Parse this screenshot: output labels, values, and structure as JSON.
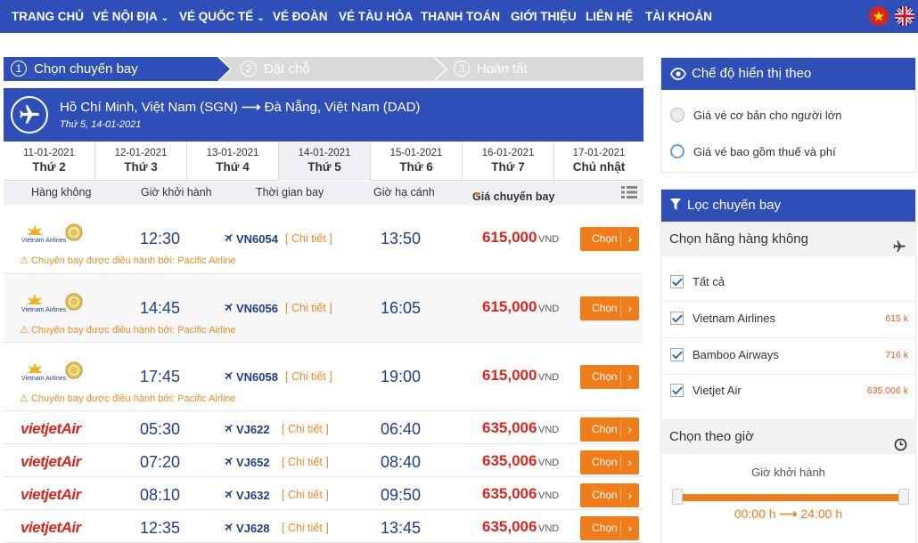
{
  "nav": {
    "items": [
      {
        "label": "TRANG CHỦ",
        "caret": false
      },
      {
        "label": "VÉ NỘI ĐỊA",
        "caret": true
      },
      {
        "label": "VÉ QUỐC TẾ",
        "caret": true
      },
      {
        "label": "VÉ ĐOÀN",
        "caret": false
      },
      {
        "label": "VÉ TÀU HỎA",
        "caret": false
      },
      {
        "label": "THANH TOÁN",
        "caret": false
      },
      {
        "label": "GIỚI THIỆU",
        "caret": false
      },
      {
        "label": "LIÊN HỆ",
        "caret": false
      },
      {
        "label": "TÀI KHOẢN",
        "caret": false
      }
    ],
    "flags": [
      "vietnam-flag-icon",
      "uk-flag-icon"
    ]
  },
  "steps": [
    {
      "num": "1",
      "label": "Chọn chuyến bay",
      "active": true
    },
    {
      "num": "2",
      "label": "Đặt chỗ",
      "active": false
    },
    {
      "num": "3",
      "label": "Hoàn tất",
      "active": false
    }
  ],
  "route": {
    "from": "Hồ Chí Minh, Việt Nam (SGN)",
    "to": "Đà Nẵng, Việt Nam (DAD)",
    "date": "Thứ 5, 14-01-2021"
  },
  "dates": [
    {
      "date": "11-01-2021",
      "day": "Thứ 2"
    },
    {
      "date": "12-01-2021",
      "day": "Thứ 3"
    },
    {
      "date": "13-01-2021",
      "day": "Thứ 4"
    },
    {
      "date": "14-01-2021",
      "day": "Thứ 5",
      "active": true
    },
    {
      "date": "15-01-2021",
      "day": "Thứ 6"
    },
    {
      "date": "16-01-2021",
      "day": "Thứ 7"
    },
    {
      "date": "17-01-2021",
      "day": "Chủ nhật"
    }
  ],
  "columns": {
    "airline": "Hàng không",
    "depart": "Giờ khởi hành",
    "duration": "Thời gian bay",
    "arrive": "Giờ hạ cánh",
    "price": "Giá chuyến bay"
  },
  "flights": [
    {
      "airline": "Vietnam Airlines",
      "depart": "12:30",
      "flight": "VN6054",
      "detail": "[ Chi tiết ]",
      "arrive": "13:50",
      "price": "615,000",
      "currency": "VND",
      "button": "Chọn",
      "note": "Chuyến bay được điều hành bởi: Pacific Airline"
    },
    {
      "airline": "Vietnam Airlines",
      "depart": "14:45",
      "flight": "VN6056",
      "detail": "[ Chi tiết ]",
      "arrive": "16:05",
      "price": "615,000",
      "currency": "VND",
      "button": "Chọn",
      "note": "Chuyến bay được điều hành bởi: Pacific Airline"
    },
    {
      "airline": "Vietnam Airlines",
      "depart": "17:45",
      "flight": "VN6058",
      "detail": "[ Chi tiết ]",
      "arrive": "19:00",
      "price": "615,000",
      "currency": "VND",
      "button": "Chọn",
      "note": "Chuyến bay được điều hành bởi: Pacific Airline"
    },
    {
      "airline": "VietjetAir",
      "depart": "05:30",
      "flight": "VJ622",
      "detail": "[ Chi tiết ]",
      "arrive": "06:40",
      "price": "635,006",
      "currency": "VND",
      "button": "Chọn"
    },
    {
      "airline": "VietjetAir",
      "depart": "07:20",
      "flight": "VJ652",
      "detail": "[ Chi tiết ]",
      "arrive": "08:40",
      "price": "635,006",
      "currency": "VND",
      "button": "Chọn"
    },
    {
      "airline": "VietjetAir",
      "depart": "08:10",
      "flight": "VJ632",
      "detail": "[ Chi tiết ]",
      "arrive": "09:50",
      "price": "635,006",
      "currency": "VND",
      "button": "Chọn"
    },
    {
      "airline": "VietjetAir",
      "depart": "12:35",
      "flight": "VJ628",
      "detail": "[ Chi tiết ]",
      "arrive": "13:45",
      "price": "635,006",
      "currency": "VND",
      "button": "Chọn"
    }
  ],
  "display": {
    "title": "Chế độ hiển thị theo",
    "options": [
      {
        "label": "Giá vé cơ bản cho người lớn",
        "selected": false
      },
      {
        "label": "Giá vé bao gồm thuế và phí",
        "selected": true
      }
    ]
  },
  "filter": {
    "title": "Lọc chuyến bay",
    "airline_title": "Chọn hãng hàng không",
    "airlines": [
      {
        "label": "Tất cả",
        "price": "",
        "checked": true
      },
      {
        "label": "Vietnam Airlines",
        "price": "615 k",
        "checked": true
      },
      {
        "label": "Bamboo Airways",
        "price": "716 k",
        "checked": true
      },
      {
        "label": "Vietjet Air",
        "price": "635.006 k",
        "checked": true
      }
    ],
    "time_title": "Chọn theo giờ",
    "depart_title": "Giờ khởi hành",
    "time_from": "00:00 h",
    "time_to": "24:00 h"
  },
  "colors": {
    "brand": "#2e4fb8",
    "accent": "#f07d1a",
    "price": "#d9261c"
  }
}
